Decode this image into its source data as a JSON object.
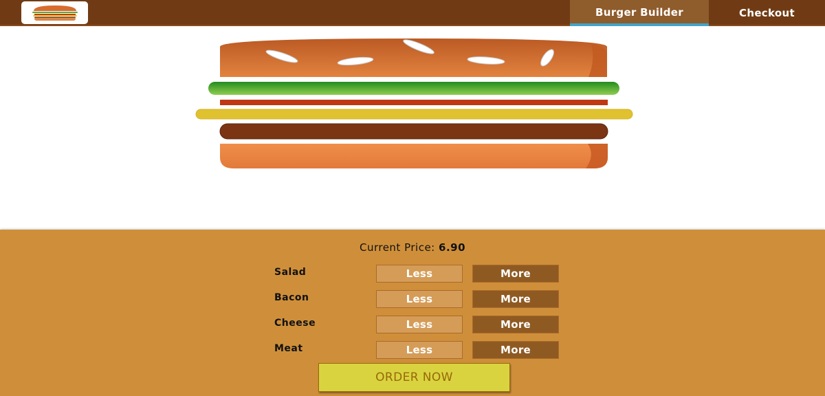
{
  "toolbar": {
    "logo_icon": "burger-logo-icon",
    "nav": [
      {
        "label": "Burger Builder",
        "active": true
      },
      {
        "label": "Checkout",
        "active": false
      }
    ]
  },
  "build_controls": {
    "price_label": "Current Price:",
    "price_value": "6.90",
    "controls": [
      {
        "label": "Salad",
        "less": "Less",
        "more": "More"
      },
      {
        "label": "Bacon",
        "less": "Less",
        "more": "More"
      },
      {
        "label": "Cheese",
        "less": "Less",
        "more": "More"
      },
      {
        "label": "Meat",
        "less": "Less",
        "more": "More"
      }
    ],
    "order_button": "ORDER NOW"
  },
  "burger": {
    "ingredients": [
      "salad",
      "bacon",
      "cheese",
      "meat"
    ]
  },
  "colors": {
    "toolbar": "#703b14",
    "active_nav": "#8f5c2c",
    "active_nav_underline": "#40a4c8",
    "controls_bg": "#cf8f3a",
    "less_button": "#d59c57",
    "more_button": "#8f5a22",
    "order_button": "#dad340"
  }
}
